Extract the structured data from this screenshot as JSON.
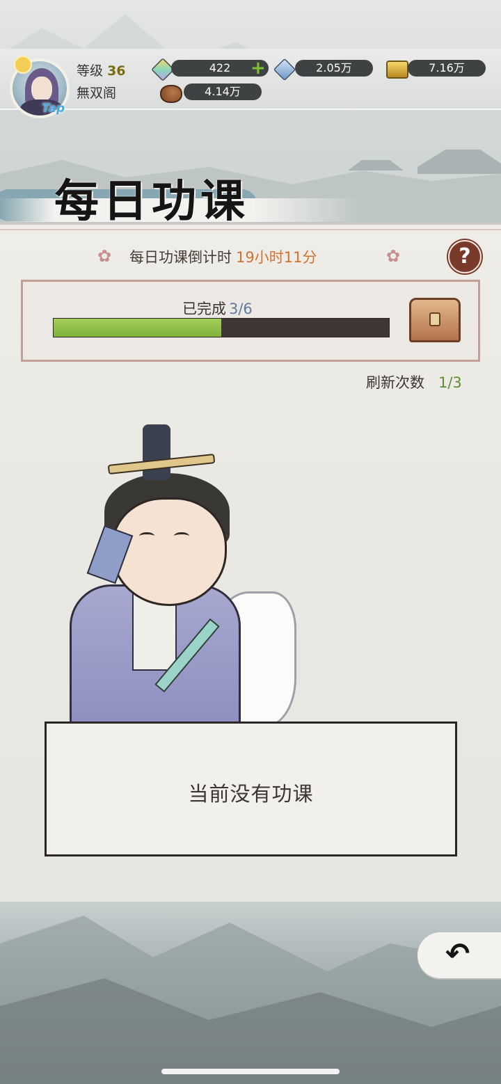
{
  "player": {
    "level_label": "等级",
    "level_value": "36",
    "guild_name": "無双阁",
    "avatar_badge": "Tap"
  },
  "resources": {
    "jade": "422",
    "crystal": "2.05万",
    "gold": "7.16万",
    "meat": "4.14万"
  },
  "title": "每日功课",
  "countdown": {
    "label": "每日功课倒计时",
    "time": "19小时11分"
  },
  "help_label": "?",
  "progress": {
    "label": "已完成",
    "done": 3,
    "total": 6,
    "fraction_text": "3/6",
    "fraction": 0.5
  },
  "refresh": {
    "label": "刷新次数",
    "count": "1/3"
  },
  "empty_message": "当前没有功课",
  "colors": {
    "accent_orange": "#d0722f",
    "progress_green": "#8fbe47",
    "help_red": "#7a3a2a"
  },
  "icons": {
    "jade": "jade-gem-icon",
    "crystal": "crystal-icon",
    "gold": "gold-ingot-icon",
    "meat": "meat-icon",
    "chest": "treasure-chest-icon",
    "back": "back-arrow-icon"
  }
}
